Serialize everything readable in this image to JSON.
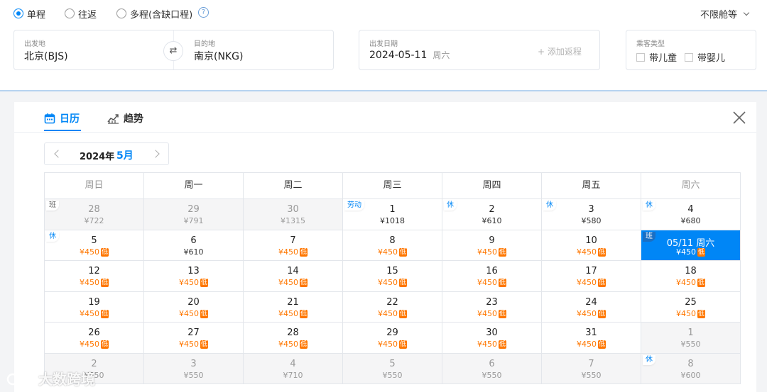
{
  "trip_types": [
    {
      "label": "单程",
      "selected": true
    },
    {
      "label": "往返",
      "selected": false
    },
    {
      "label": "多程(含缺口程)",
      "selected": false
    }
  ],
  "help_icon": "question-circle-icon",
  "cabin": {
    "label": "不限舱等"
  },
  "origin": {
    "label": "出发地",
    "value": "北京(BJS)"
  },
  "destination": {
    "label": "目的地",
    "value": "南京(NKG)"
  },
  "depart": {
    "label": "出发日期",
    "date": "2024-05-11",
    "weekday": "周六",
    "add_return": "+ 添加返程"
  },
  "passenger": {
    "label": "乘客类型",
    "child": "带儿童",
    "infant": "带婴儿"
  },
  "tabs": [
    {
      "label": "日历",
      "icon": "calendar-icon",
      "active": true
    },
    {
      "label": "趋势",
      "icon": "trend-chart-icon",
      "active": false
    }
  ],
  "month_nav": {
    "year": "2024年",
    "month": "5月"
  },
  "weekdays": [
    "周日",
    "周一",
    "周二",
    "周三",
    "周四",
    "周五",
    "周六"
  ],
  "days": [
    {
      "day": "28",
      "price": "¥722",
      "other": true,
      "tag": "班",
      "tag_type": "work"
    },
    {
      "day": "29",
      "price": "¥791",
      "other": true
    },
    {
      "day": "30",
      "price": "¥1315",
      "other": true
    },
    {
      "day": "1",
      "price": "¥1018",
      "tag": "劳动",
      "tag_type": "rest"
    },
    {
      "day": "2",
      "price": "¥610",
      "tag": "休",
      "tag_type": "rest"
    },
    {
      "day": "3",
      "price": "¥580",
      "tag": "休",
      "tag_type": "rest"
    },
    {
      "day": "4",
      "price": "¥680",
      "tag": "休",
      "tag_type": "rest"
    },
    {
      "day": "5",
      "price": "¥450",
      "low": true,
      "tag": "休",
      "tag_type": "rest"
    },
    {
      "day": "6",
      "price": "¥610"
    },
    {
      "day": "7",
      "price": "¥450",
      "low": true
    },
    {
      "day": "8",
      "price": "¥450",
      "low": true
    },
    {
      "day": "9",
      "price": "¥450",
      "low": true
    },
    {
      "day": "10",
      "price": "¥450",
      "low": true
    },
    {
      "day": "05/11 周六",
      "price": "¥450",
      "low": true,
      "selected": true,
      "tag": "班",
      "tag_type": "work"
    },
    {
      "day": "12",
      "price": "¥450",
      "low": true
    },
    {
      "day": "13",
      "price": "¥450",
      "low": true
    },
    {
      "day": "14",
      "price": "¥450",
      "low": true
    },
    {
      "day": "15",
      "price": "¥450",
      "low": true
    },
    {
      "day": "16",
      "price": "¥450",
      "low": true
    },
    {
      "day": "17",
      "price": "¥450",
      "low": true
    },
    {
      "day": "18",
      "price": "¥450",
      "low": true
    },
    {
      "day": "19",
      "price": "¥450",
      "low": true
    },
    {
      "day": "20",
      "price": "¥450",
      "low": true
    },
    {
      "day": "21",
      "price": "¥450",
      "low": true
    },
    {
      "day": "22",
      "price": "¥450",
      "low": true
    },
    {
      "day": "23",
      "price": "¥450",
      "low": true
    },
    {
      "day": "24",
      "price": "¥450",
      "low": true
    },
    {
      "day": "25",
      "price": "¥450",
      "low": true
    },
    {
      "day": "26",
      "price": "¥450",
      "low": true
    },
    {
      "day": "27",
      "price": "¥450",
      "low": true
    },
    {
      "day": "28",
      "price": "¥450",
      "low": true
    },
    {
      "day": "29",
      "price": "¥450",
      "low": true
    },
    {
      "day": "30",
      "price": "¥450",
      "low": true
    },
    {
      "day": "31",
      "price": "¥450",
      "low": true
    },
    {
      "day": "1",
      "price": "¥550",
      "other": true
    },
    {
      "day": "2",
      "price": "¥550",
      "other": true
    },
    {
      "day": "3",
      "price": "¥550",
      "other": true
    },
    {
      "day": "4",
      "price": "¥710",
      "other": true
    },
    {
      "day": "5",
      "price": "¥550",
      "other": true
    },
    {
      "day": "6",
      "price": "¥550",
      "other": true
    },
    {
      "day": "7",
      "price": "¥550",
      "other": true
    },
    {
      "day": "8",
      "price": "¥600",
      "other": true,
      "tag": "休",
      "tag_type": "rest"
    }
  ],
  "low_badge": "低",
  "watermark": "大数跨境",
  "colors": {
    "accent": "#0086f6",
    "low_price": "#ff7700"
  }
}
